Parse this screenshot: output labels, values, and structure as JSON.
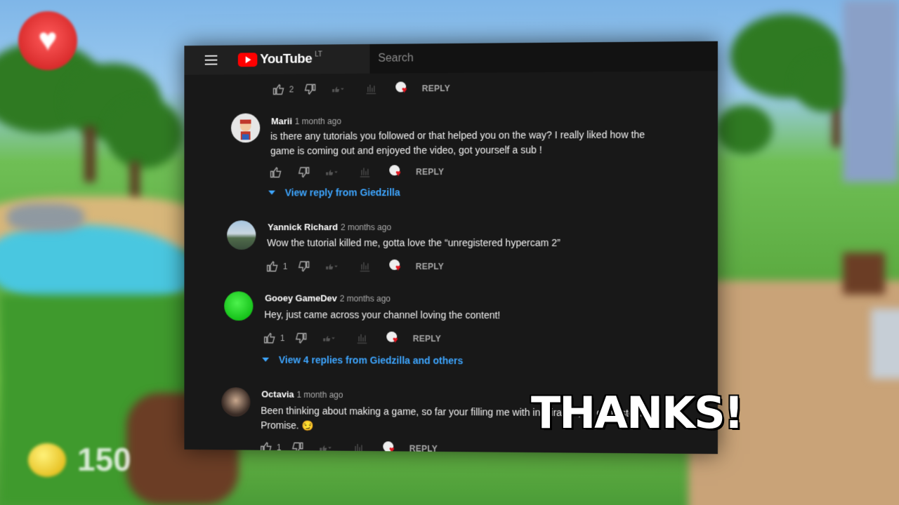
{
  "game": {
    "heart_icon": "heart-icon",
    "coin_icon": "coin-icon",
    "coin_count": "150"
  },
  "youtube": {
    "logo_text": "YouTube",
    "region": "LT",
    "search_placeholder": "Search",
    "reply_label": "REPLY",
    "comments": [
      {
        "author": "",
        "time": "",
        "text": "",
        "likes": "2"
      },
      {
        "author": "Marii",
        "time": "1 month ago",
        "text": "is there any tutorials you followed or that helped you on the way? I really liked how the game is coming out and enjoyed the video, got yourself a sub !",
        "likes": "",
        "view_replies": "View reply from Giedzilla"
      },
      {
        "author": "Yannick Richard",
        "time": "2 months ago",
        "text": "Wow the tutorial killed me, gotta love the “unregistered hypercam 2”",
        "likes": "1"
      },
      {
        "author": "Gooey GameDev",
        "time": "2 months ago",
        "text": "Hey, just came across your channel loving the content!",
        "likes": "1",
        "view_replies": "View 4 replies from Giedzilla and others"
      },
      {
        "author": "Octavia",
        "time": "1 month ago",
        "text": "Been thinking about making a game, so far your filling me with inspiration, so don't steal. Promise. 😏",
        "likes": "1"
      }
    ]
  },
  "overlay": {
    "thanks": "THANKS!"
  },
  "colors": {
    "accent_link": "#3ea6ff",
    "youtube_red": "#ff0000",
    "heart_red": "#e0151f"
  }
}
